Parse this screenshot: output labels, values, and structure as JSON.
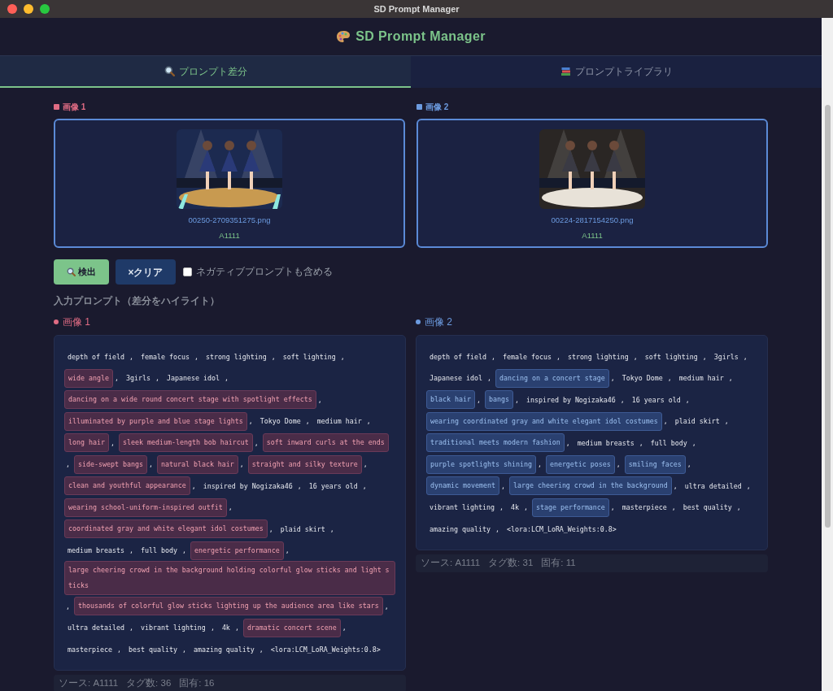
{
  "window": {
    "title": "SD Prompt Manager"
  },
  "app_title": "SD Prompt Manager",
  "tabs": [
    {
      "label": "プロンプト差分",
      "selected": true
    },
    {
      "label": "プロンプトライブラリ",
      "selected": false
    }
  ],
  "images": [
    {
      "label": "画像 1",
      "color": "#e06c84",
      "filename": "00250-2709351275.png",
      "source": "A1111"
    },
    {
      "label": "画像 2",
      "color": "#6c9be0",
      "filename": "00224-2817154250.png",
      "source": "A1111"
    }
  ],
  "detect_button": "検出",
  "clear_button": "×クリア",
  "negative_checkbox": {
    "label": "ネガティブプロンプトも含める",
    "checked": false
  },
  "section_label": "入力プロンプト（差分をハイライト）",
  "separator": ",",
  "panels": [
    {
      "label": "画像 1",
      "color": "#e06c84",
      "stats": [
        "ソース: A1111",
        "タグ数: 36",
        "固有: 16"
      ],
      "tags": [
        {
          "text": "depth of field",
          "diff": false
        },
        {
          "text": "female focus",
          "diff": false
        },
        {
          "text": "strong lighting",
          "diff": false
        },
        {
          "text": "soft lighting",
          "diff": false
        },
        {
          "text": "wide angle",
          "diff": true
        },
        {
          "text": "3girls",
          "diff": false
        },
        {
          "text": "Japanese idol",
          "diff": false
        },
        {
          "text": "dancing on a wide round concert stage with spotlight effects",
          "diff": true
        },
        {
          "text": "illuminated by purple and blue stage lights",
          "diff": true
        },
        {
          "text": "Tokyo Dome",
          "diff": false
        },
        {
          "text": "medium hair",
          "diff": false
        },
        {
          "text": "long hair",
          "diff": true
        },
        {
          "text": "sleek medium-length bob haircut",
          "diff": true
        },
        {
          "text": "soft inward curls at the ends",
          "diff": true
        },
        {
          "text": "side-swept bangs",
          "diff": true
        },
        {
          "text": "natural black hair",
          "diff": true
        },
        {
          "text": "straight and silky texture",
          "diff": true
        },
        {
          "text": "clean and youthful appearance",
          "diff": true
        },
        {
          "text": "inspired by Nogizaka46",
          "diff": false
        },
        {
          "text": "16 years old",
          "diff": false
        },
        {
          "text": "wearing school-uniform-inspired outfit",
          "diff": true
        },
        {
          "text": "coordinated gray and white elegant idol costumes",
          "diff": true
        },
        {
          "text": "plaid skirt",
          "diff": false
        },
        {
          "text": "medium breasts",
          "diff": false
        },
        {
          "text": "full body",
          "diff": false
        },
        {
          "text": "energetic performance",
          "diff": true
        },
        {
          "text": "large cheering crowd in the background holding colorful glow sticks and light sticks",
          "diff": true
        },
        {
          "text": "thousands of colorful glow sticks lighting up the audience area like stars",
          "diff": true
        },
        {
          "text": "ultra detailed",
          "diff": false
        },
        {
          "text": "vibrant lighting",
          "diff": false
        },
        {
          "text": "4k",
          "diff": false
        },
        {
          "text": "dramatic concert scene",
          "diff": true
        },
        {
          "text": "masterpiece",
          "diff": false
        },
        {
          "text": "best quality",
          "diff": false
        },
        {
          "text": "amazing quality",
          "diff": false
        },
        {
          "text": "<lora:LCM_LoRA_Weights:0.8>",
          "diff": false
        }
      ]
    },
    {
      "label": "画像 2",
      "color": "#6c9be0",
      "stats": [
        "ソース: A1111",
        "タグ数: 31",
        "固有: 11"
      ],
      "tags": [
        {
          "text": "depth of field",
          "diff": false
        },
        {
          "text": "female focus",
          "diff": false
        },
        {
          "text": "strong lighting",
          "diff": false
        },
        {
          "text": "soft lighting",
          "diff": false
        },
        {
          "text": "3girls",
          "diff": false
        },
        {
          "text": "Japanese idol",
          "diff": false
        },
        {
          "text": "dancing on a concert stage",
          "diff": true
        },
        {
          "text": "Tokyo Dome",
          "diff": false
        },
        {
          "text": "medium hair",
          "diff": false
        },
        {
          "text": "black hair",
          "diff": true
        },
        {
          "text": "bangs",
          "diff": true
        },
        {
          "text": "inspired by Nogizaka46",
          "diff": false
        },
        {
          "text": "16 years old",
          "diff": false
        },
        {
          "text": "wearing coordinated gray and white elegant idol costumes",
          "diff": true
        },
        {
          "text": "plaid skirt",
          "diff": false
        },
        {
          "text": "traditional meets modern fashion",
          "diff": true
        },
        {
          "text": "medium breasts",
          "diff": false
        },
        {
          "text": "full body",
          "diff": false
        },
        {
          "text": "purple spotlights shining",
          "diff": true
        },
        {
          "text": "energetic poses",
          "diff": true
        },
        {
          "text": "smiling faces",
          "diff": true
        },
        {
          "text": "dynamic movement",
          "diff": true
        },
        {
          "text": "large cheering crowd in the background",
          "diff": true
        },
        {
          "text": "ultra detailed",
          "diff": false
        },
        {
          "text": "vibrant lighting",
          "diff": false
        },
        {
          "text": "4k",
          "diff": false
        },
        {
          "text": "stage performance",
          "diff": true
        },
        {
          "text": "masterpiece",
          "diff": false
        },
        {
          "text": "best quality",
          "diff": false
        },
        {
          "text": "amazing quality",
          "diff": false
        },
        {
          "text": "<lora:LCM_LoRA_Weights:0.8>",
          "diff": false
        }
      ]
    }
  ]
}
